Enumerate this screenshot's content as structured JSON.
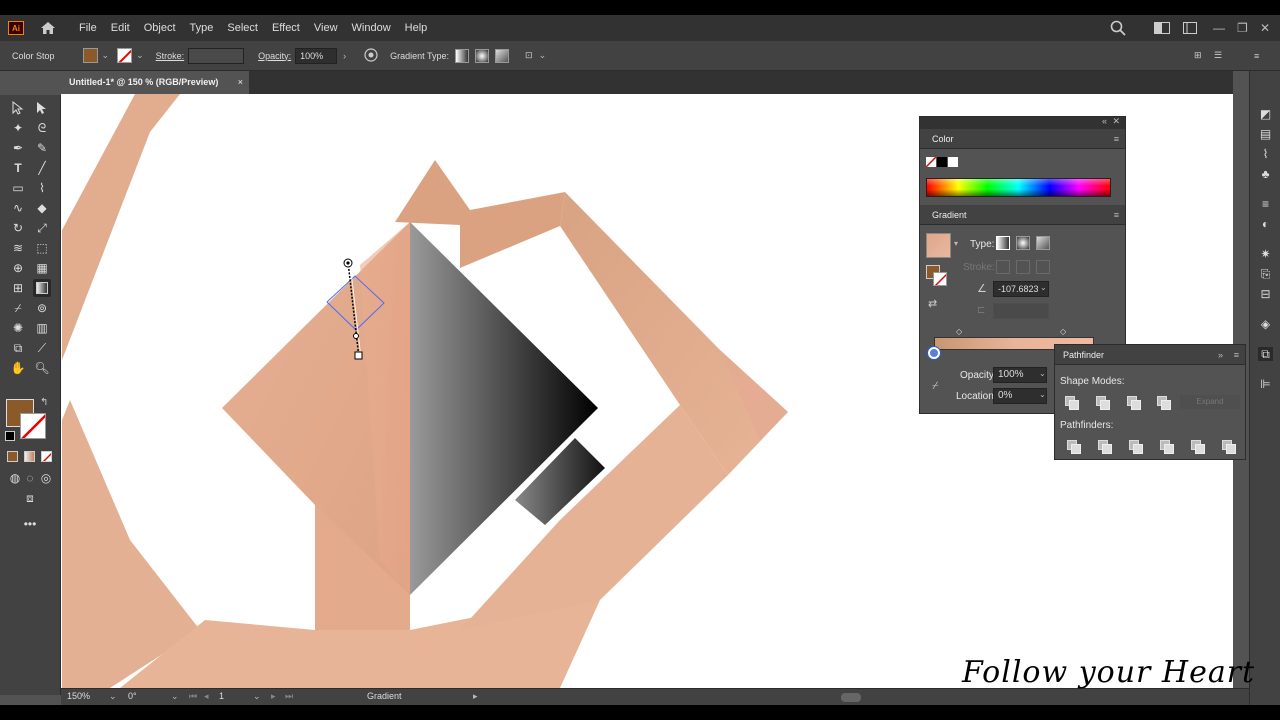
{
  "app": {
    "logo": "Ai"
  },
  "menu": [
    "File",
    "Edit",
    "Object",
    "Type",
    "Select",
    "Effect",
    "View",
    "Window",
    "Help"
  ],
  "control_bar": {
    "context_label": "Color Stop",
    "stroke_label": "Stroke:",
    "opacity_label": "Opacity:",
    "opacity_value": "100%",
    "gradient_type_label": "Gradient Type:"
  },
  "document_tab": {
    "title": "Untitled-1* @ 150 % (RGB/Preview)",
    "close": "×"
  },
  "status_bar": {
    "zoom": "150%",
    "rotation": "0°",
    "artboard": "1",
    "tool": "Gradient"
  },
  "color_panel": {
    "title": "Color"
  },
  "gradient_panel": {
    "title": "Gradient",
    "type_label": "Type:",
    "stroke_label": "Stroke:",
    "angle_value": "-107.6823",
    "opacity_label": "Opacity:",
    "opacity_value": "100%",
    "location_label": "Location:",
    "location_value": "0%"
  },
  "pathfinder_panel": {
    "title": "Pathfinder",
    "shape_modes_label": "Shape Modes:",
    "expand_label": "Expand",
    "pathfinders_label": "Pathfinders:"
  },
  "watermark": "Follow your Heart",
  "colors": {
    "fill": "#8a5a2b",
    "skin": "#e3ab8c",
    "skin_light": "#e8b497",
    "panel_bg": "#535353",
    "selection": "#4a6cf7"
  }
}
